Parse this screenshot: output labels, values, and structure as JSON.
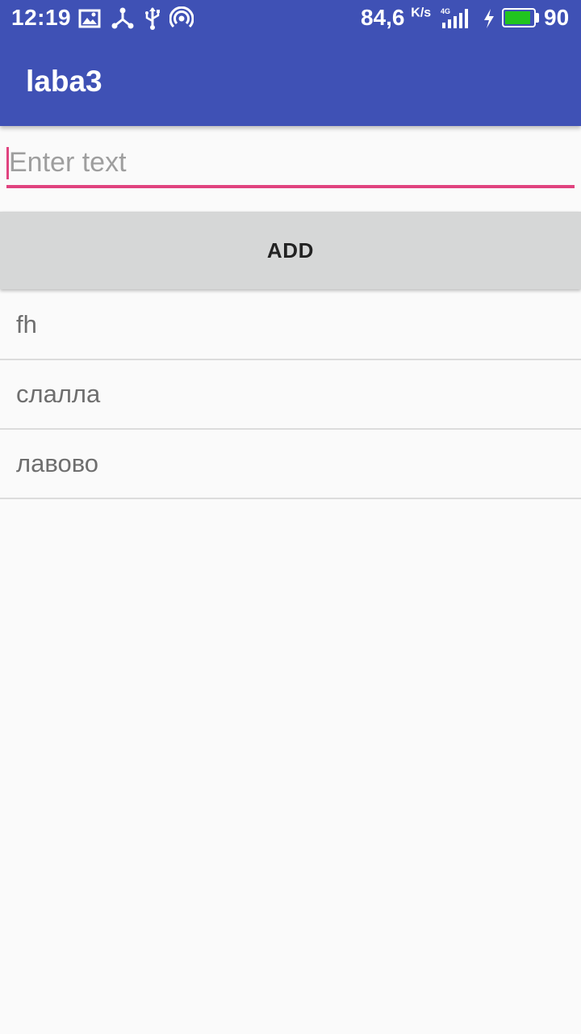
{
  "status_bar": {
    "time": "12:19",
    "icons": [
      "image-icon",
      "share-icon",
      "usb-icon",
      "hotspot-icon",
      "signal-icon",
      "charging-icon",
      "battery-icon"
    ],
    "network_speed": "84,6",
    "network_speed_unit": "K/s",
    "network_type": "4G",
    "battery_level": "90",
    "battery_fraction": 0.9,
    "battery_color": "#21c41f"
  },
  "app_bar": {
    "title": "laba3",
    "color": "#3f51b5"
  },
  "input": {
    "value": "",
    "placeholder": "Enter text",
    "accent_color": "#e0437f"
  },
  "add_button": {
    "label": "ADD"
  },
  "list": {
    "items": [
      "fh",
      "слалла",
      "лавово"
    ]
  }
}
